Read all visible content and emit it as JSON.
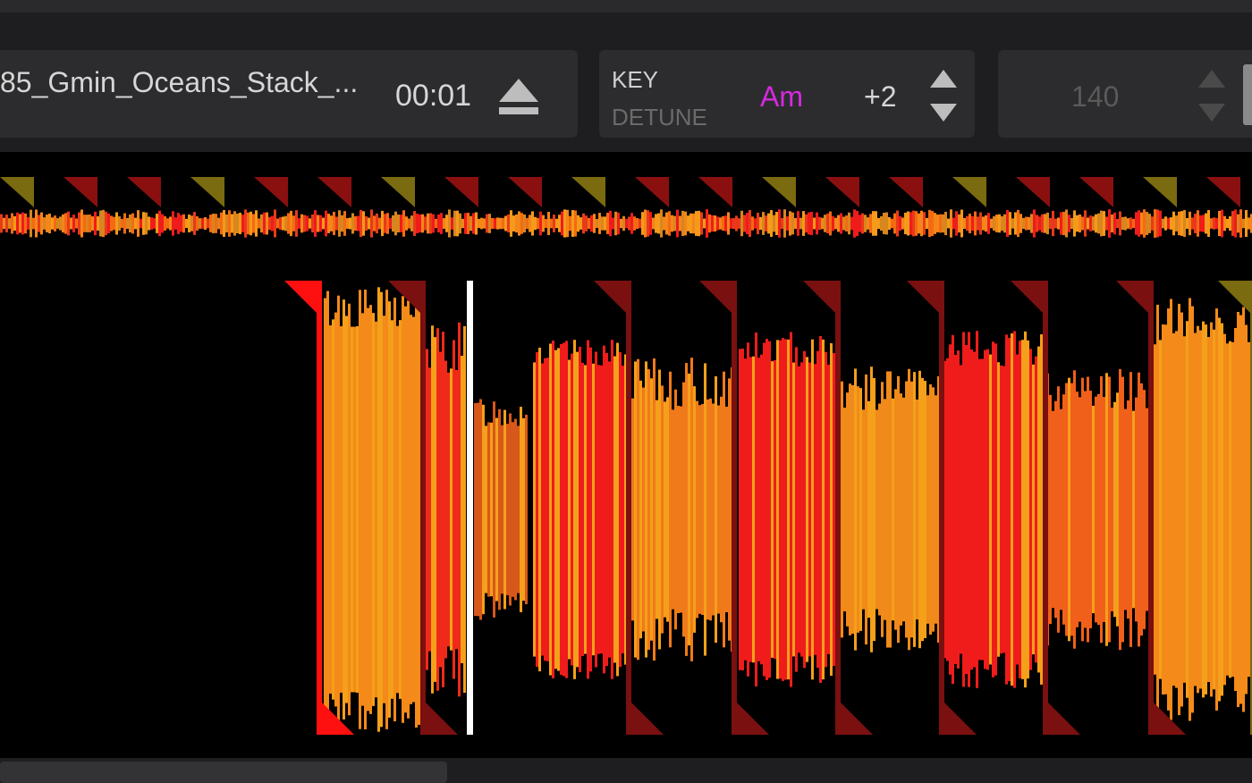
{
  "deck": {
    "track_name": "85_Gmin_Oceans_Stack_...",
    "time": "00:01",
    "eject_icon": "eject-icon"
  },
  "key": {
    "label": "KEY",
    "detune_label": "DETUNE",
    "value": "Am",
    "offset": "+2",
    "value_color": "#d629e0"
  },
  "bpm": {
    "value": "140"
  },
  "colors": {
    "wave_red": "#f01c1c",
    "wave_orange": "#f4861a",
    "playhead": "#ffffff"
  }
}
